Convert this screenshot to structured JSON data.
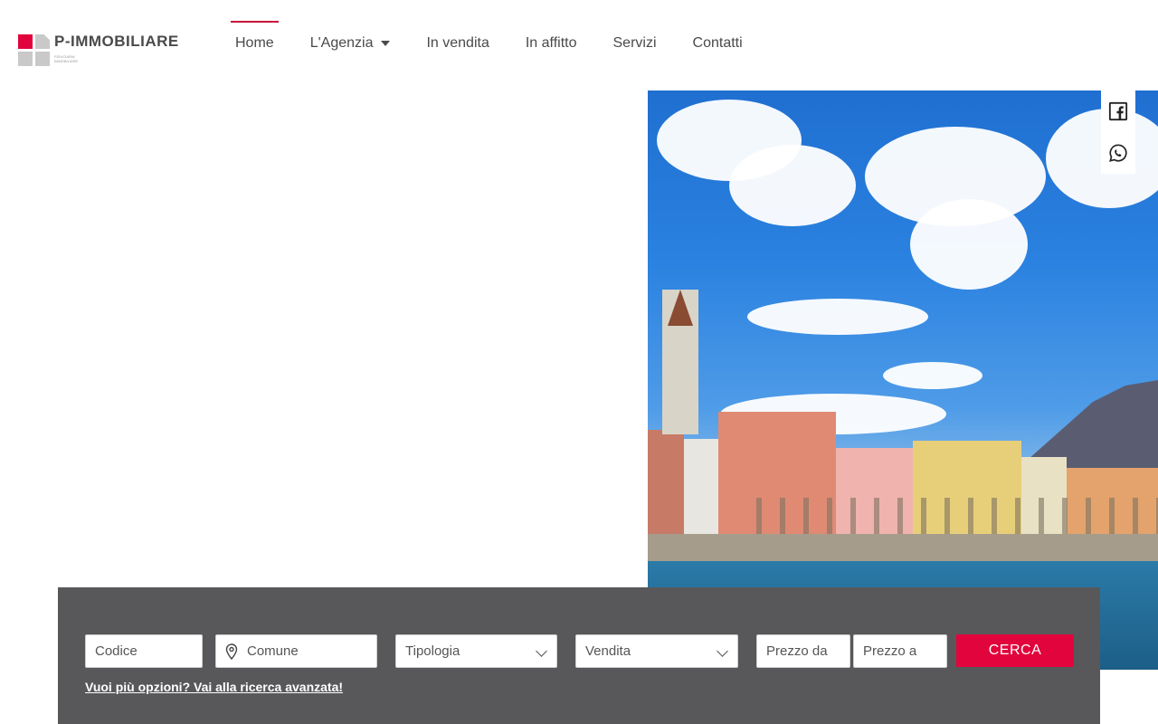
{
  "brand": {
    "name": "P-IMMOBILIARE",
    "tagline": "FIDUCIARIA IMMOBILIARE",
    "colors": {
      "accent": "#e2043c",
      "nav_active_line": "#c7103a",
      "logo_gray": "#c9c9c9",
      "search_bg": "#58585a"
    }
  },
  "nav": {
    "items": [
      {
        "label": "Home",
        "active": true
      },
      {
        "label": "L'Agenzia",
        "has_dropdown": true
      },
      {
        "label": "In vendita"
      },
      {
        "label": "In affitto"
      },
      {
        "label": "Servizi"
      },
      {
        "label": "Contatti"
      }
    ]
  },
  "social": {
    "icons": [
      "facebook-icon",
      "whatsapp-icon"
    ]
  },
  "search": {
    "codice_placeholder": "Codice",
    "comune_placeholder": "Comune",
    "tipologia_value": "Tipologia",
    "contratto_value": "Vendita",
    "prezzo_da_placeholder": "Prezzo da",
    "prezzo_a_placeholder": "Prezzo a",
    "button_label": "CERCA",
    "advanced_link": "Vuoi più opzioni? Vai alla ricerca avanzata!"
  }
}
